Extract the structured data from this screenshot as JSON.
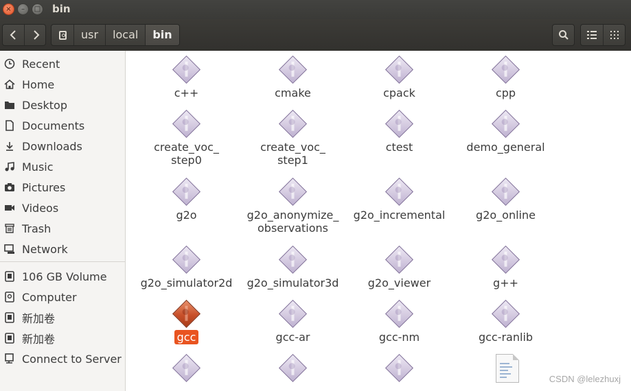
{
  "window": {
    "title": "bin",
    "close_glyph": "×",
    "min_glyph": "–",
    "max_glyph": "□"
  },
  "toolbar": {
    "back_icon": "chevron-left-icon",
    "forward_icon": "chevron-right-icon",
    "breadcrumbs": [
      "usr",
      "local",
      "bin"
    ],
    "active_crumb": "bin",
    "search_icon": "search-icon",
    "list_view_icon": "list-view-icon",
    "grid_view_icon": "grid-view-icon"
  },
  "sidebar": {
    "items": [
      {
        "label": "Recent",
        "icon": "clock-icon"
      },
      {
        "label": "Home",
        "icon": "home-icon"
      },
      {
        "label": "Desktop",
        "icon": "folder-icon"
      },
      {
        "label": "Documents",
        "icon": "document-icon"
      },
      {
        "label": "Downloads",
        "icon": "download-icon"
      },
      {
        "label": "Music",
        "icon": "music-icon"
      },
      {
        "label": "Pictures",
        "icon": "camera-icon"
      },
      {
        "label": "Videos",
        "icon": "video-icon"
      },
      {
        "label": "Trash",
        "icon": "trash-icon"
      },
      {
        "label": "Network",
        "icon": "network-icon"
      },
      {
        "label": "106 GB Volume",
        "icon": "drive-icon"
      },
      {
        "label": "Computer",
        "icon": "drive-icon"
      },
      {
        "label": "新加卷",
        "icon": "drive-icon"
      },
      {
        "label": "新加卷",
        "icon": "drive-icon"
      },
      {
        "label": "Connect to Server",
        "icon": "server-icon"
      }
    ]
  },
  "files": [
    {
      "name": "c++",
      "icon": "executable-icon"
    },
    {
      "name": "cmake",
      "icon": "executable-icon"
    },
    {
      "name": "cpack",
      "icon": "executable-icon"
    },
    {
      "name": "cpp",
      "icon": "executable-icon"
    },
    {
      "name": "create_voc_\nstep0",
      "icon": "executable-icon"
    },
    {
      "name": "create_voc_\nstep1",
      "icon": "executable-icon"
    },
    {
      "name": "ctest",
      "icon": "executable-icon"
    },
    {
      "name": "demo_general",
      "icon": "executable-icon"
    },
    {
      "name": "g2o",
      "icon": "executable-icon"
    },
    {
      "name": "g2o_anonymize_\nobservations",
      "icon": "executable-icon"
    },
    {
      "name": "g2o_incremental",
      "icon": "executable-icon"
    },
    {
      "name": "g2o_online",
      "icon": "executable-icon"
    },
    {
      "name": "g2o_simulator2d",
      "icon": "executable-icon"
    },
    {
      "name": "g2o_simulator3d",
      "icon": "executable-icon"
    },
    {
      "name": "g2o_viewer",
      "icon": "executable-icon"
    },
    {
      "name": "g++",
      "icon": "executable-icon"
    },
    {
      "name": "gcc",
      "icon": "executable-icon",
      "selected": true
    },
    {
      "name": "gcc-ar",
      "icon": "executable-icon"
    },
    {
      "name": "gcc-nm",
      "icon": "executable-icon"
    },
    {
      "name": "gcc-ranlib",
      "icon": "executable-icon"
    },
    {
      "name": "",
      "icon": "executable-icon"
    },
    {
      "name": "",
      "icon": "executable-icon"
    },
    {
      "name": "",
      "icon": "executable-icon"
    },
    {
      "name": "",
      "icon": "text-file-icon"
    }
  ],
  "watermark": "CSDN @lelezhuxj",
  "colors": {
    "accent": "#e95420",
    "titlebar": "#3c3b37",
    "sidebar_bg": "#f5f4f2",
    "exec_icon": "#c9bddc"
  }
}
